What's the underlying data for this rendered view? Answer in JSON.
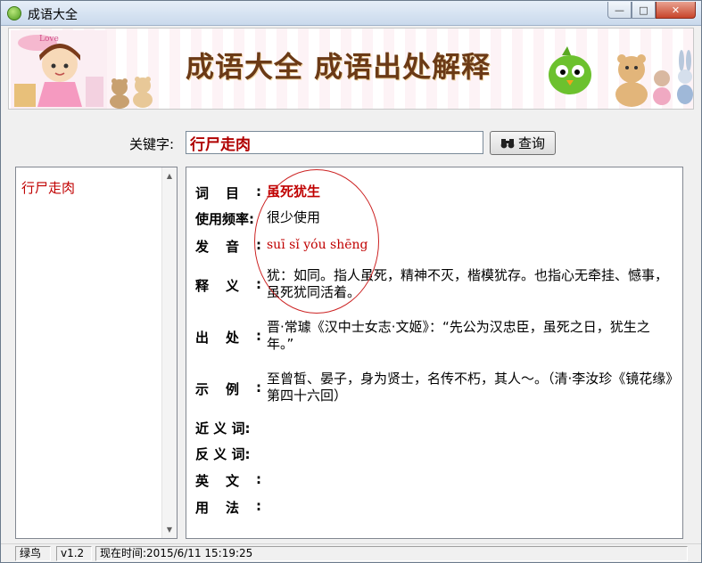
{
  "window": {
    "title": "成语大全",
    "minimize": "—",
    "maximize": "□",
    "close": "✕"
  },
  "banner": {
    "title": "成语大全  成语出处解释",
    "love_text": "Love"
  },
  "search": {
    "label": "关键字:",
    "value": "行尸走肉",
    "button_label": "查询"
  },
  "list": {
    "items": [
      "行尸走肉"
    ]
  },
  "detail": {
    "rows": [
      {
        "label": "词　　目:",
        "value": "虽死犹生"
      },
      {
        "label": "使用频率:",
        "value": "很少使用"
      },
      {
        "label": "发　　音:",
        "value": "suī sǐ yóu shēng"
      },
      {
        "label": "释　　义:",
        "value": "犹：如同。指人虽死，精神不灭，楷模犹存。也指心无牵挂、憾事，虽死犹同活着。"
      },
      {
        "label": "出　　处:",
        "value": "晋·常璩《汉中士女志·文姬》：“先公为汉忠臣，虽死之日，犹生之年。”"
      },
      {
        "label": "示　　例:",
        "value": "至曾皙、晏子，身为贤士，名传不朽，其人～。（清·李汝珍《镜花缘》第四十六回）"
      },
      {
        "label": "近 义 词:",
        "value": ""
      },
      {
        "label": "反 义 词:",
        "value": ""
      },
      {
        "label": "英　　文:",
        "value": ""
      },
      {
        "label": "用　　法:",
        "value": ""
      }
    ]
  },
  "status": {
    "app_name": "绿鸟",
    "version": "v1.2",
    "time": "现在时间:2015/6/11 15:19:25"
  },
  "icons": {
    "app": "green-bird-icon",
    "search": "binoculars-icon"
  },
  "colors": {
    "accent_red": "#c00000",
    "banner_title": "#6b3a16"
  }
}
